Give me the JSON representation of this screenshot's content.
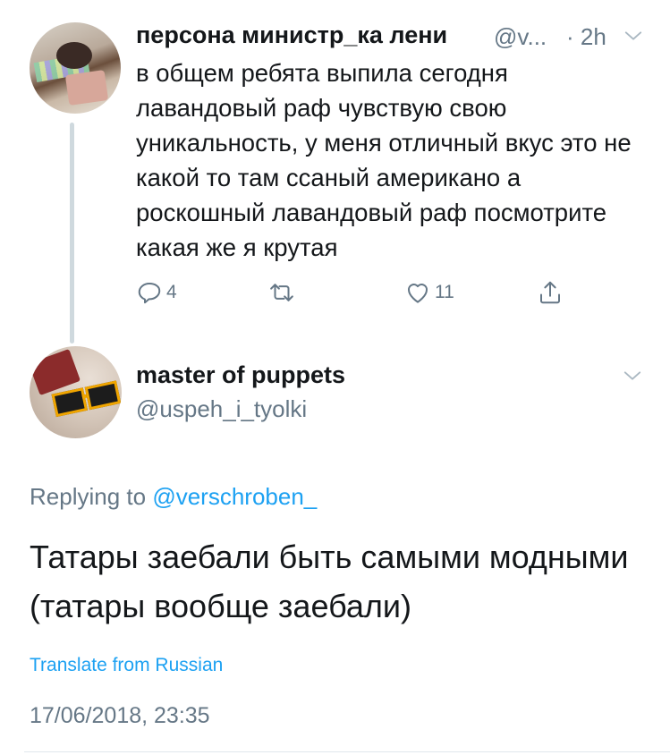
{
  "thread": {
    "parent": {
      "display_name": "персона министр_ка лени",
      "handle": "@v...",
      "time": "· 2h",
      "text": "в общем ребята выпила сегодня лавандовый раф чувствую свою уникальность, у меня отличный вкус это не какой то там ссаный американо а роскошный лавандовый раф посмотрите какая же я крутая",
      "replies": "4",
      "likes": "11",
      "icons": [
        "reply-icon",
        "retweet-icon",
        "like-icon",
        "share-icon",
        "chevron-down-icon"
      ]
    },
    "reply": {
      "display_name": "master of puppets",
      "handle": "@uspeh_i_tyolki",
      "replying_prefix": "Replying to",
      "replying_to": "@verschroben_",
      "text": "Татары заебали быть самыми модными (татары вообще заебали)",
      "translate": "Translate from Russian",
      "timestamp": "17/06/2018, 23:35"
    }
  },
  "colors": {
    "text": "#14171a",
    "secondary": "#657786",
    "link": "#1da1f2",
    "divider": "#e1e8ed"
  }
}
